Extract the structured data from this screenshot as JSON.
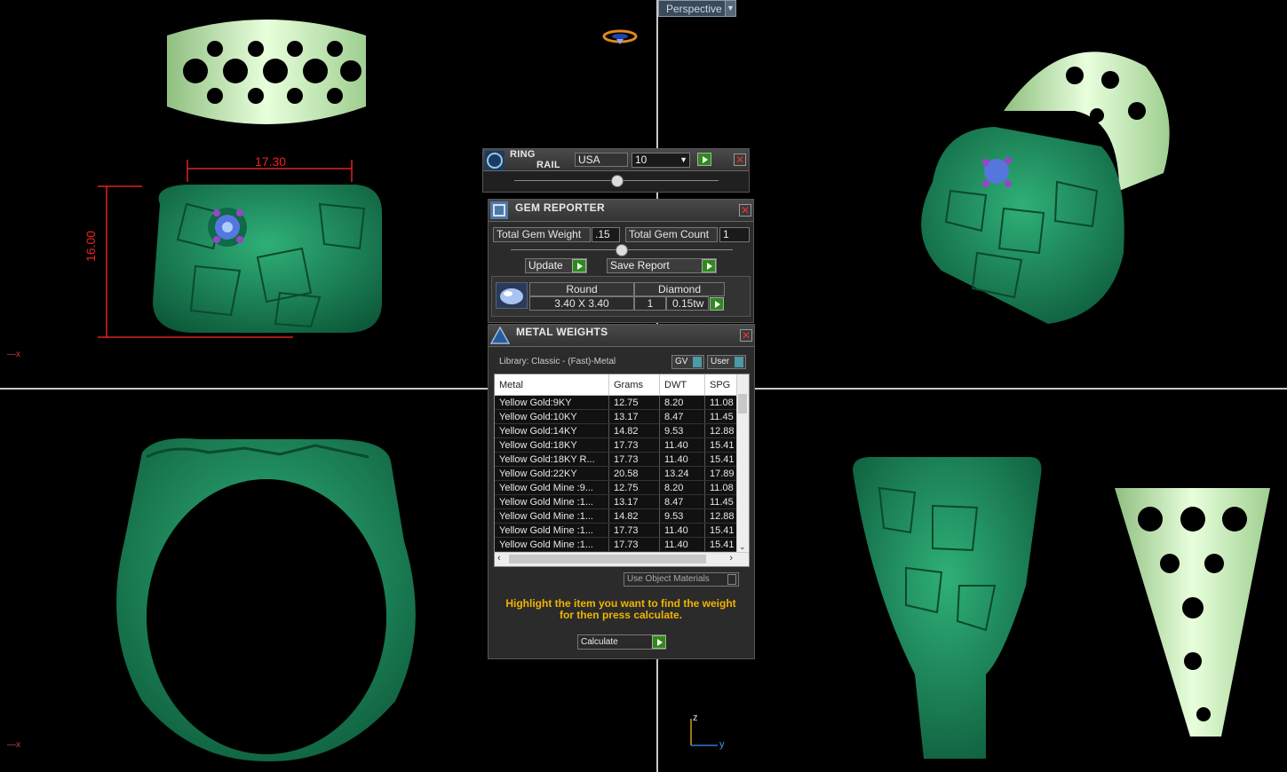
{
  "viewport": {
    "perspective_label": "Perspective",
    "dimension_width": "17.30",
    "dimension_height": "16.00",
    "axis_x_label": "x",
    "axis_z_label": "z",
    "axis_y_label": "y"
  },
  "ring_rail": {
    "title_line1": "RING",
    "title_line2": "RAIL",
    "region": "USA",
    "size": "10"
  },
  "gem_reporter": {
    "title": "GEM REPORTER",
    "total_weight_label": "Total Gem Weight",
    "total_weight_value": ".15",
    "total_count_label": "Total Gem Count",
    "total_count_value": "1",
    "update_label": "Update",
    "save_report_label": "Save Report",
    "gem": {
      "shape": "Round",
      "type": "Diamond",
      "dimensions": "3.40 X 3.40",
      "count": "1",
      "weight": "0.15tw"
    }
  },
  "metal_weights": {
    "title": "METAL WEIGHTS",
    "library": "Library: Classic - (Fast)-Metal",
    "gv_label": "GV",
    "user_label": "User",
    "columns": [
      "Metal",
      "Grams",
      "DWT",
      "SPG"
    ],
    "rows": [
      [
        "Yellow Gold:9KY",
        "12.75",
        "8.20",
        "11.08"
      ],
      [
        "Yellow Gold:10KY",
        "13.17",
        "8.47",
        "11.45"
      ],
      [
        "Yellow Gold:14KY",
        "14.82",
        "9.53",
        "12.88"
      ],
      [
        "Yellow Gold:18KY",
        "17.73",
        "11.40",
        "15.41"
      ],
      [
        "Yellow Gold:18KY R...",
        "17.73",
        "11.40",
        "15.41"
      ],
      [
        "Yellow Gold:22KY",
        "20.58",
        "13.24",
        "17.89"
      ],
      [
        "Yellow Gold Mine :9...",
        "12.75",
        "8.20",
        "11.08"
      ],
      [
        "Yellow Gold Mine :1...",
        "13.17",
        "8.47",
        "11.45"
      ],
      [
        "Yellow Gold Mine :1...",
        "14.82",
        "9.53",
        "12.88"
      ],
      [
        "Yellow Gold Mine :1...",
        "17.73",
        "11.40",
        "15.41"
      ],
      [
        "Yellow Gold Mine :1...",
        "17.73",
        "11.40",
        "15.41"
      ]
    ],
    "use_object_materials": "Use Object Materials",
    "hint": "Highlight the item you want to find the weight for then press calculate.",
    "calculate_label": "Calculate"
  }
}
